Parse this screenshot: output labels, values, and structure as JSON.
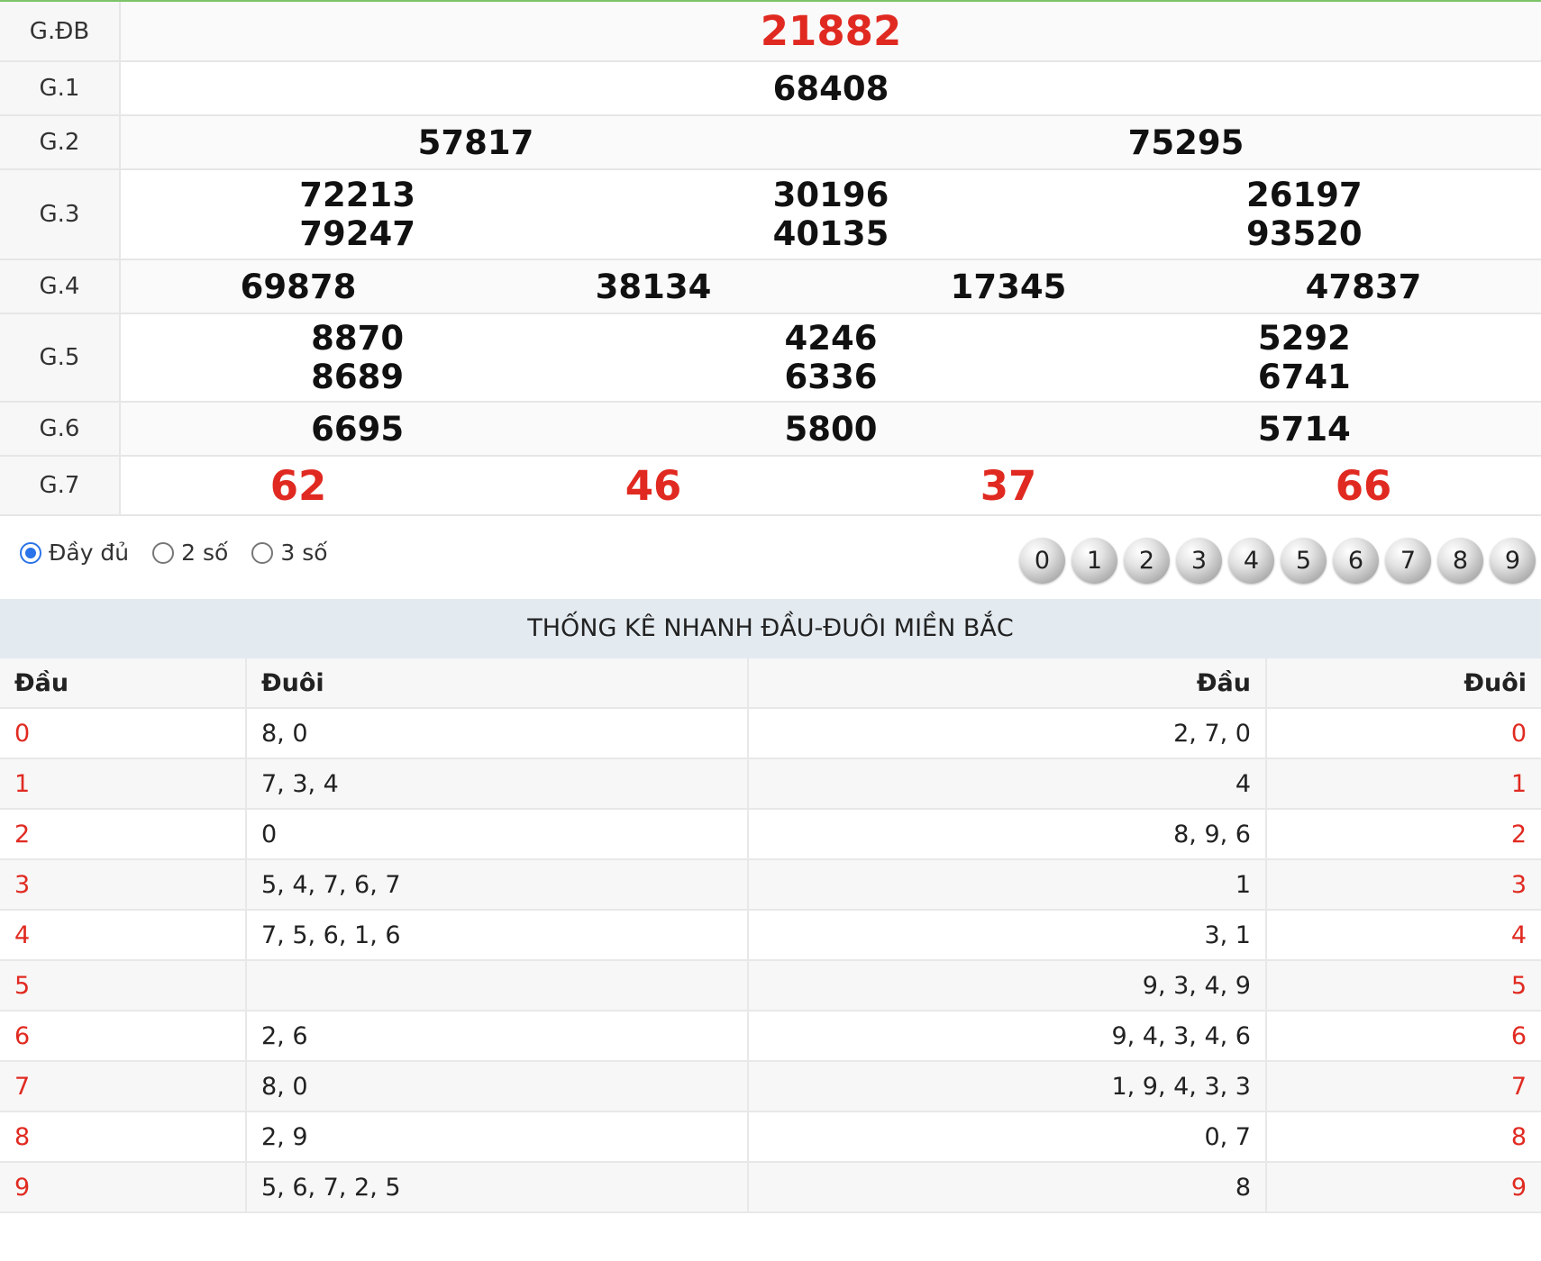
{
  "results": [
    {
      "label": "G.ĐB",
      "highlight": true,
      "cells": [
        [
          "21882"
        ]
      ]
    },
    {
      "label": "G.1",
      "cells": [
        [
          "68408"
        ]
      ]
    },
    {
      "label": "G.2",
      "cells": [
        [
          "57817"
        ],
        [
          "75295"
        ]
      ]
    },
    {
      "label": "G.3",
      "cells": [
        [
          "72213",
          "79247"
        ],
        [
          "30196",
          "40135"
        ],
        [
          "26197",
          "93520"
        ]
      ]
    },
    {
      "label": "G.4",
      "cells": [
        [
          "69878"
        ],
        [
          "38134"
        ],
        [
          "17345"
        ],
        [
          "47837"
        ]
      ]
    },
    {
      "label": "G.5",
      "cells": [
        [
          "8870",
          "8689"
        ],
        [
          "4246",
          "6336"
        ],
        [
          "5292",
          "6741"
        ]
      ]
    },
    {
      "label": "G.6",
      "cells": [
        [
          "6695"
        ],
        [
          "5800"
        ],
        [
          "5714"
        ]
      ]
    },
    {
      "label": "G.7",
      "highlight": true,
      "cells": [
        [
          "62"
        ],
        [
          "46"
        ],
        [
          "37"
        ],
        [
          "66"
        ]
      ]
    }
  ],
  "options": {
    "radios": [
      {
        "label": "Đầy đủ",
        "checked": true
      },
      {
        "label": "2 số",
        "checked": false
      },
      {
        "label": "3 số",
        "checked": false
      }
    ],
    "digit_buttons": [
      "0",
      "1",
      "2",
      "3",
      "4",
      "5",
      "6",
      "7",
      "8",
      "9"
    ]
  },
  "stats": {
    "title": "THỐNG KÊ NHANH ĐẦU-ĐUÔI MIỀN BẮC",
    "headers": [
      "Đầu",
      "Đuôi",
      "Đầu",
      "Đuôi"
    ],
    "rows": [
      {
        "dau": "0",
        "duoi": "8, 0",
        "dau2": "2, 7, 0",
        "duoi2": "0"
      },
      {
        "dau": "1",
        "duoi": "7, 3, 4",
        "dau2": "4",
        "duoi2": "1"
      },
      {
        "dau": "2",
        "duoi": "0",
        "dau2": "8, 9, 6",
        "duoi2": "2"
      },
      {
        "dau": "3",
        "duoi": "5, 4, 7, 6, 7",
        "dau2": "1",
        "duoi2": "3"
      },
      {
        "dau": "4",
        "duoi": "7, 5, 6, 1, 6",
        "dau2": "3, 1",
        "duoi2": "4"
      },
      {
        "dau": "5",
        "duoi": "",
        "dau2": "9, 3, 4, 9",
        "duoi2": "5"
      },
      {
        "dau": "6",
        "duoi": "2, 6",
        "dau2": "9, 4, 3, 4, 6",
        "duoi2": "6"
      },
      {
        "dau": "7",
        "duoi": "8, 0",
        "dau2": "1, 9, 4, 3, 3",
        "duoi2": "7"
      },
      {
        "dau": "8",
        "duoi": "2, 9",
        "dau2": "0, 7",
        "duoi2": "8"
      },
      {
        "dau": "9",
        "duoi": "5, 6, 7, 2, 5",
        "dau2": "8",
        "duoi2": "9"
      }
    ]
  },
  "colors": {
    "highlight": "#e02a21",
    "accent_line": "#7cc36a",
    "radio_checked": "#2a73e8"
  }
}
